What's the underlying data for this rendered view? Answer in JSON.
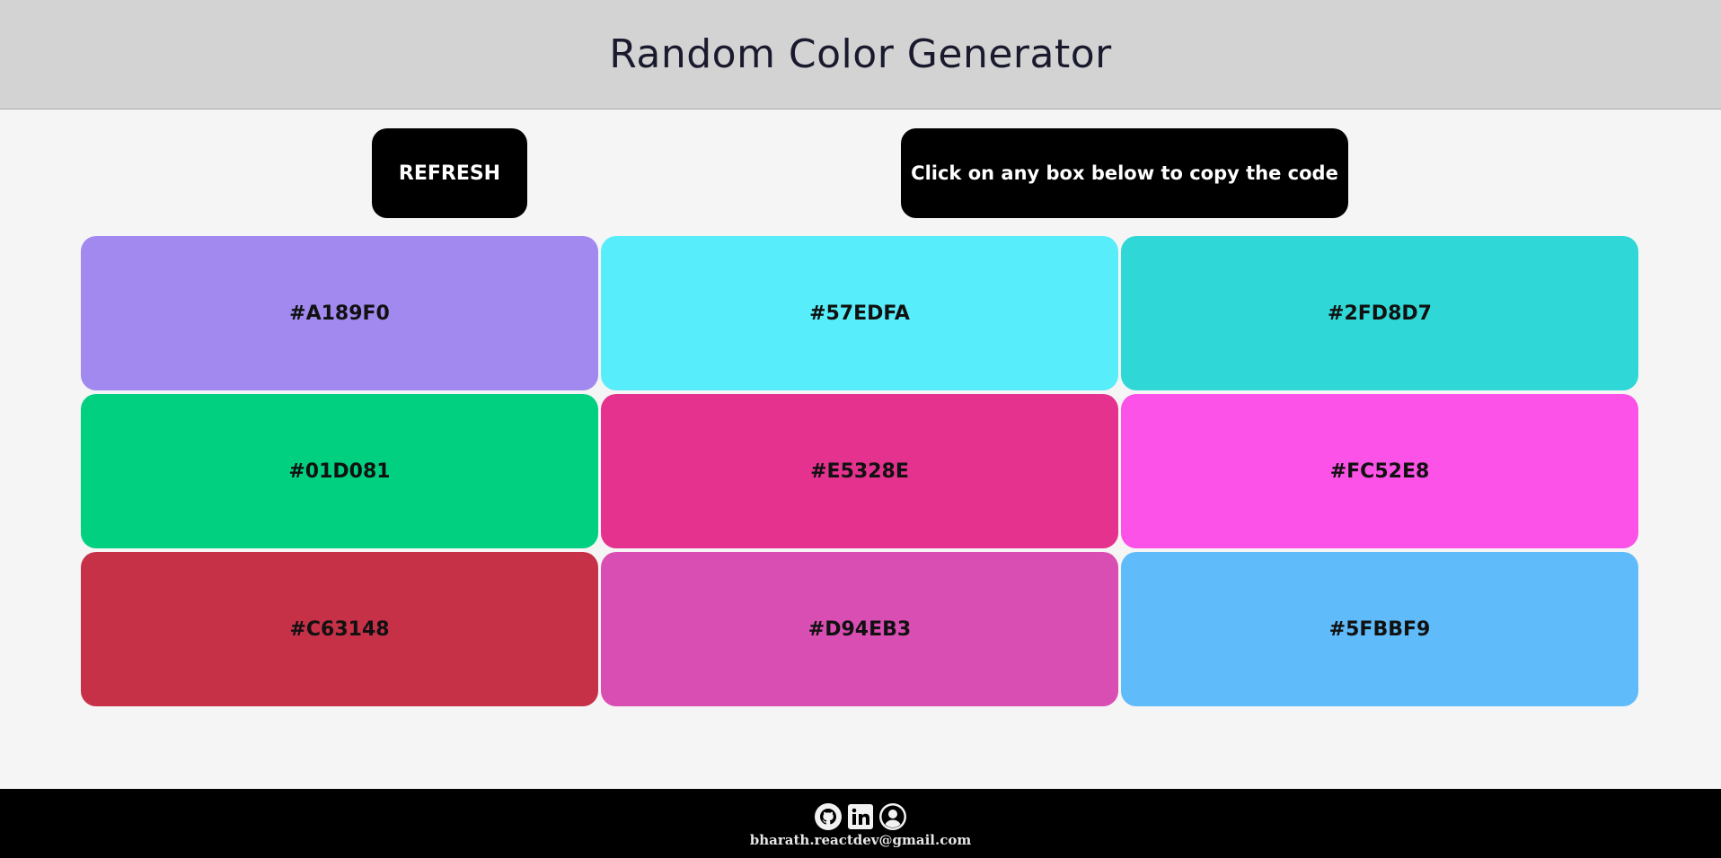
{
  "header": {
    "title": "Random Color Generator"
  },
  "controls": {
    "refresh_label": "REFRESH",
    "copy_hint": "Click on any box below to copy the code"
  },
  "swatches": [
    {
      "code": "#A189F0",
      "color": "#A189F0"
    },
    {
      "code": "#57EDFA",
      "color": "#57EDFA"
    },
    {
      "code": "#2FD8D7",
      "color": "#2FD8D7"
    },
    {
      "code": "#01D081",
      "color": "#01D081"
    },
    {
      "code": "#E5328E",
      "color": "#E5328E"
    },
    {
      "code": "#FC52E8",
      "color": "#FC52E8"
    },
    {
      "code": "#C63148",
      "color": "#C63148"
    },
    {
      "code": "#D94EB3",
      "color": "#D94EB3"
    },
    {
      "code": "#5FBBF9",
      "color": "#5FBBF9"
    }
  ],
  "footer": {
    "icons": [
      "github-icon",
      "linkedin-icon",
      "profile-icon"
    ],
    "email": "bharath.reactdev@gmail.com"
  }
}
